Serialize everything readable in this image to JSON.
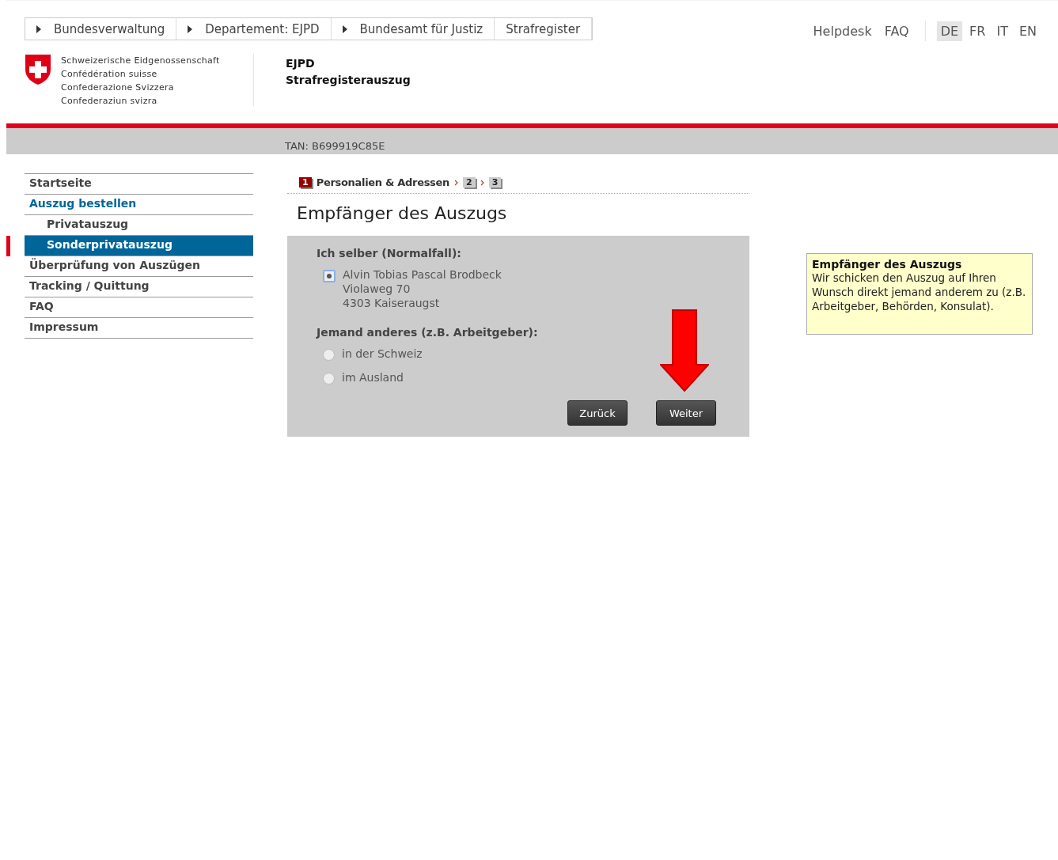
{
  "breadcrumb": [
    {
      "label": "Bundesverwaltung",
      "has_caret": true
    },
    {
      "label": "Departement: EJPD",
      "has_caret": true
    },
    {
      "label": "Bundesamt für Justiz",
      "has_caret": true
    },
    {
      "label": "Strafregister",
      "has_caret": false
    }
  ],
  "service_links": [
    "Helpdesk",
    "FAQ"
  ],
  "languages": [
    {
      "label": "DE",
      "selected": true
    },
    {
      "label": "FR",
      "selected": false
    },
    {
      "label": "IT",
      "selected": false
    },
    {
      "label": "EN",
      "selected": false
    }
  ],
  "logo_lines": [
    "Schweizerische Eidgenossenschaft",
    "Confédération suisse",
    "Confederazione Svizzera",
    "Confederaziun svizra"
  ],
  "site_title": [
    "EJPD",
    "Strafregisterauszug"
  ],
  "tan": "TAN: B699919C85E",
  "sidebar": {
    "items": [
      {
        "label": "Startseite",
        "selected": false,
        "expanded": false
      },
      {
        "label": "Auszug bestellen",
        "selected": false,
        "expanded": true,
        "children": [
          {
            "label": "Privatauszug",
            "selected": false
          },
          {
            "label": "Sonderprivatauszug",
            "selected": true
          }
        ]
      },
      {
        "label": "Überprüfung von Auszügen",
        "selected": false,
        "expanded": false
      },
      {
        "label": "Tracking / Quittung",
        "selected": false,
        "expanded": false
      },
      {
        "label": "FAQ",
        "selected": false,
        "expanded": false
      },
      {
        "label": "Impressum",
        "selected": false,
        "expanded": false
      }
    ]
  },
  "steps": [
    {
      "number": "1",
      "label": "Personalien & Adressen",
      "selected": true
    },
    {
      "number": "2",
      "selected": false
    },
    {
      "number": "3",
      "selected": false
    }
  ],
  "heading": "Empfänger des Auszugs",
  "form": {
    "groups": [
      {
        "title": "Ich selber (Normalfall):",
        "options": [
          {
            "lines": [
              "Alvin Tobias Pascal Brodbeck",
              "Violaweg 70",
              "4303 Kaiseraugst"
            ],
            "checked": true
          }
        ]
      },
      {
        "title": "Jemand anderes (z.B. Arbeitgeber):",
        "options": [
          {
            "lines": [
              "in der Schweiz"
            ],
            "checked": false
          },
          {
            "lines": [
              "im Ausland"
            ],
            "checked": false
          }
        ]
      }
    ],
    "buttons": [
      "Zurück",
      "Weiter"
    ]
  },
  "help_box": {
    "title": "Empfänger des Auszugs",
    "text": "Wir schicken den Auszug auf Ihren Wunsch direkt jemand anderem zu (z.B. Arbeitgeber, Behörden, Konsulat)."
  }
}
